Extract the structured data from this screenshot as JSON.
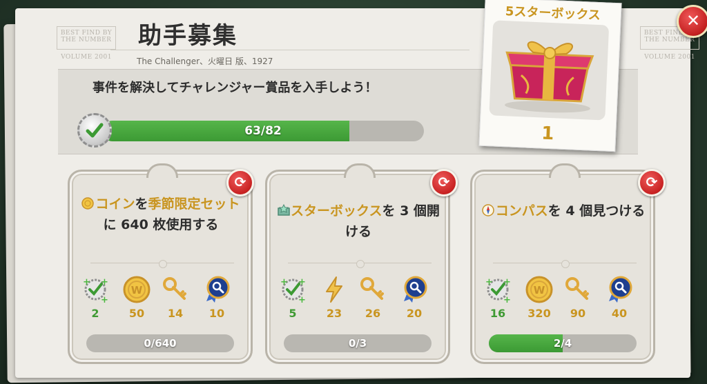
{
  "header": {
    "title": "助手募集",
    "subtitle": "The Challenger、火曜日 版、1927",
    "masthead_left": "BEST FIND BY THE NUMBER",
    "masthead_left_sub": "VOLUME 2001",
    "masthead_right": "BEST FIND BY THE NUMBER",
    "masthead_right_sub": "VOLUME 2001"
  },
  "main_task": {
    "description": "事件を解決してチャレンジャー賞品を入手しよう！",
    "progress_text": "63/82",
    "progress_current": 63,
    "progress_total": 82
  },
  "prize": {
    "title": "5スターボックス",
    "count": "1"
  },
  "cards": [
    {
      "text_parts": [
        {
          "t": "コイン",
          "hl": true
        },
        {
          "t": "を",
          "hl": false
        },
        {
          "t": "季節限定セット",
          "hl": true
        },
        {
          "t": "に 640 枚使用する",
          "hl": false
        }
      ],
      "icon": "coin-icon",
      "rewards": [
        {
          "icon": "energy-check-icon",
          "value": "2",
          "color": "green"
        },
        {
          "icon": "gold-coin-icon",
          "value": "50",
          "color": "gold"
        },
        {
          "icon": "key-icon",
          "value": "14",
          "color": "gold"
        },
        {
          "icon": "magnifier-badge-icon",
          "value": "10",
          "color": "gold"
        }
      ],
      "progress_text": "0/640",
      "progress_fraction": 0
    },
    {
      "text_parts": [
        {
          "t": "スターボックス",
          "hl": true
        },
        {
          "t": "を 3 個開ける",
          "hl": false
        }
      ],
      "icon": "star-box-icon",
      "rewards": [
        {
          "icon": "energy-check-icon",
          "value": "5",
          "color": "green"
        },
        {
          "icon": "lightning-icon",
          "value": "23",
          "color": "gold"
        },
        {
          "icon": "key-icon",
          "value": "26",
          "color": "gold"
        },
        {
          "icon": "magnifier-badge-icon",
          "value": "20",
          "color": "gold"
        }
      ],
      "progress_text": "0/3",
      "progress_fraction": 0
    },
    {
      "text_parts": [
        {
          "t": "コンパス",
          "hl": true
        },
        {
          "t": "を 4 個見つける",
          "hl": false
        }
      ],
      "icon": "compass-icon",
      "rewards": [
        {
          "icon": "energy-check-icon",
          "value": "16",
          "color": "green"
        },
        {
          "icon": "gold-coin-icon",
          "value": "320",
          "color": "gold"
        },
        {
          "icon": "key-icon",
          "value": "90",
          "color": "gold"
        },
        {
          "icon": "magnifier-badge-icon",
          "value": "40",
          "color": "gold"
        }
      ],
      "progress_text": "2/4",
      "progress_fraction": 0.5
    }
  ],
  "colors": {
    "accent_gold": "#c99520",
    "progress_green": "#3c9a34",
    "refresh_red": "#c82222"
  }
}
